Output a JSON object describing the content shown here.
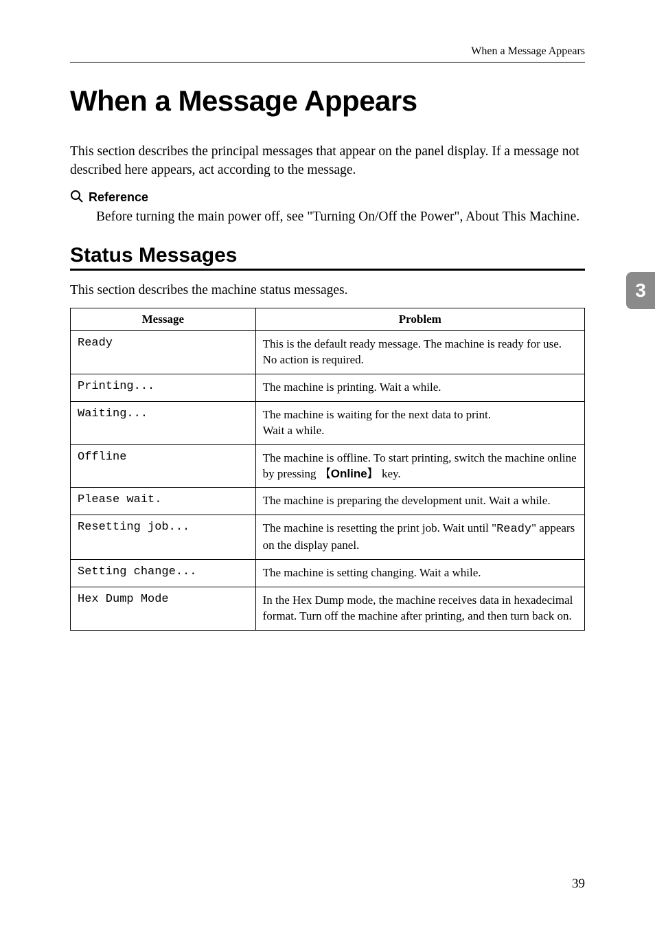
{
  "running_head": "When a Message Appears",
  "main_title": "When a Message Appears",
  "intro": "This section describes the principal messages that appear on the panel display. If a message not described here appears, act according to the message.",
  "reference_heading": "Reference",
  "reference_body": "Before turning the main power off, see \"Turning On/Off the Power\", About This Machine.",
  "status_title": "Status Messages",
  "status_intro": "This section describes the machine status messages.",
  "table": {
    "headers": {
      "message": "Message",
      "problem": "Problem"
    },
    "rows": [
      {
        "msg": "Ready",
        "problem_html": "This is the default ready message. The machine is ready for use. No action is required."
      },
      {
        "msg": "Printing...",
        "problem_html": "The machine is printing. Wait a while."
      },
      {
        "msg": "Waiting...",
        "problem_html": "The machine is waiting for the next data to print.<br>Wait a while."
      },
      {
        "msg": "Offline",
        "problem_html": "The machine is offline. To start printing, switch the machine online by pressing <span class=\"key\">Online</span> key."
      },
      {
        "msg": "Please wait.",
        "problem_html": "The machine is preparing the development unit. Wait a while."
      },
      {
        "msg": "Resetting job...",
        "problem_html": "The machine is resetting the print job. Wait until \"<span class=\"mono\">Ready</span>\" appears on the display panel."
      },
      {
        "msg": "Setting change...",
        "problem_html": "The machine is setting changing. Wait a while."
      },
      {
        "msg": "Hex Dump Mode",
        "problem_html": "In the Hex Dump mode, the machine receives data in hexadecimal format. Turn off the machine after printing, and then turn back on."
      }
    ]
  },
  "page_number": "39",
  "tab": "3"
}
